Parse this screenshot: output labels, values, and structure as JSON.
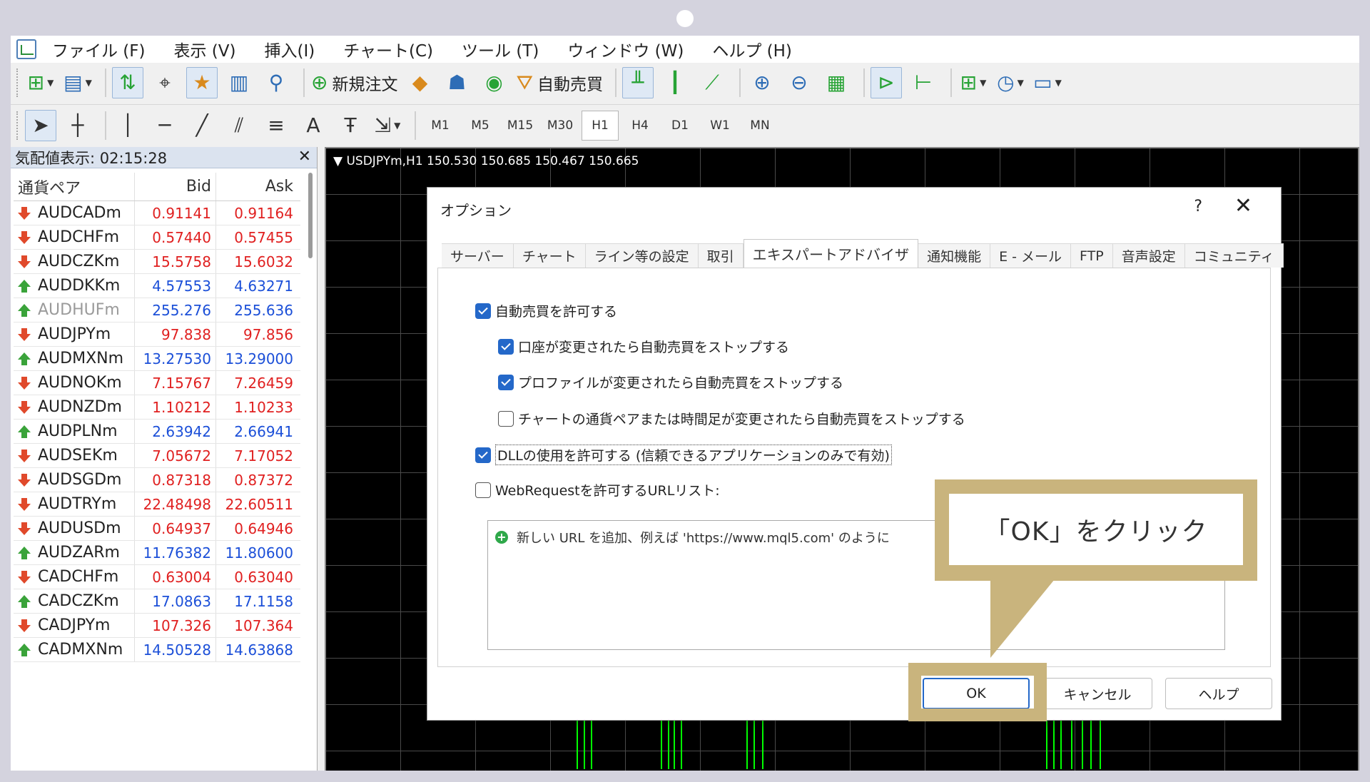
{
  "menu": [
    "ファイル (F)",
    "表示 (V)",
    "挿入(I)",
    "チャート(C)",
    "ツール (T)",
    "ウィンドウ (W)",
    "ヘルプ (H)"
  ],
  "toolbar": {
    "new_order_label": "新規注文",
    "auto_trade_label": "自動売買",
    "timeframes": [
      "M1",
      "M5",
      "M15",
      "M30",
      "H1",
      "H4",
      "D1",
      "W1",
      "MN"
    ],
    "active_timeframe": "H1"
  },
  "market_watch": {
    "title": "気配値表示: 02:15:28",
    "headers": [
      "通貨ペア",
      "Bid",
      "Ask"
    ],
    "rows": [
      {
        "symbol": "AUDCADm",
        "bid": "0.91141",
        "ask": "0.91164",
        "dir": "down"
      },
      {
        "symbol": "AUDCHFm",
        "bid": "0.57440",
        "ask": "0.57455",
        "dir": "down"
      },
      {
        "symbol": "AUDCZKm",
        "bid": "15.5758",
        "ask": "15.6032",
        "dir": "down"
      },
      {
        "symbol": "AUDDKKm",
        "bid": "4.57553",
        "ask": "4.63271",
        "dir": "up"
      },
      {
        "symbol": "AUDHUFm",
        "bid": "255.276",
        "ask": "255.636",
        "dir": "up",
        "muted": true
      },
      {
        "symbol": "AUDJPYm",
        "bid": "97.838",
        "ask": "97.856",
        "dir": "down"
      },
      {
        "symbol": "AUDMXNm",
        "bid": "13.27530",
        "ask": "13.29000",
        "dir": "up"
      },
      {
        "symbol": "AUDNOKm",
        "bid": "7.15767",
        "ask": "7.26459",
        "dir": "down"
      },
      {
        "symbol": "AUDNZDm",
        "bid": "1.10212",
        "ask": "1.10233",
        "dir": "down"
      },
      {
        "symbol": "AUDPLNm",
        "bid": "2.63942",
        "ask": "2.66941",
        "dir": "up"
      },
      {
        "symbol": "AUDSEKm",
        "bid": "7.05672",
        "ask": "7.17052",
        "dir": "down"
      },
      {
        "symbol": "AUDSGDm",
        "bid": "0.87318",
        "ask": "0.87372",
        "dir": "down"
      },
      {
        "symbol": "AUDTRYm",
        "bid": "22.48498",
        "ask": "22.60511",
        "dir": "down"
      },
      {
        "symbol": "AUDUSDm",
        "bid": "0.64937",
        "ask": "0.64946",
        "dir": "down"
      },
      {
        "symbol": "AUDZARm",
        "bid": "11.76382",
        "ask": "11.80600",
        "dir": "up"
      },
      {
        "symbol": "CADCHFm",
        "bid": "0.63004",
        "ask": "0.63040",
        "dir": "down"
      },
      {
        "symbol": "CADCZKm",
        "bid": "17.0863",
        "ask": "17.1158",
        "dir": "up"
      },
      {
        "symbol": "CADJPYm",
        "bid": "107.326",
        "ask": "107.364",
        "dir": "down"
      },
      {
        "symbol": "CADMXNm",
        "bid": "14.50528",
        "ask": "14.63868",
        "dir": "up"
      }
    ]
  },
  "chart": {
    "title": "USDJPYm,H1  150.530 150.685 150.467 150.665"
  },
  "dialog": {
    "title": "オプション",
    "help_glyph": "?",
    "tabs": [
      "サーバー",
      "チャート",
      "ライン等の設定",
      "取引",
      "エキスパートアドバイザ",
      "通知機能",
      "E - メール",
      "FTP",
      "音声設定",
      "コミュニティ"
    ],
    "active_tab": "エキスパートアドバイザ",
    "options": [
      {
        "label": "自動売買を許可する",
        "checked": true
      },
      {
        "label": "口座が変更されたら自動売買をストップする",
        "checked": true
      },
      {
        "label": "プロファイルが変更されたら自動売買をストップする",
        "checked": true
      },
      {
        "label": "チャートの通貨ペアまたは時間足が変更されたら自動売買をストップする",
        "checked": false
      },
      {
        "label": "DLLの使用を許可する (信頼できるアプリケーションのみで有効)",
        "checked": true
      },
      {
        "label": "WebRequestを許可するURLリスト:",
        "checked": false
      }
    ],
    "url_placeholder": "新しい URL を追加、例えば 'https://www.mql5.com' のように",
    "buttons": {
      "ok": "OK",
      "cancel": "キャンセル",
      "help": "ヘルプ"
    }
  },
  "callout": {
    "text": "「OK」をクリック",
    "color": "#c9b47d"
  },
  "colors": {
    "bid_down": "#e02020",
    "bid_up": "#1b4fd8",
    "candle": "#00ff00",
    "accent": "#2468c9"
  }
}
